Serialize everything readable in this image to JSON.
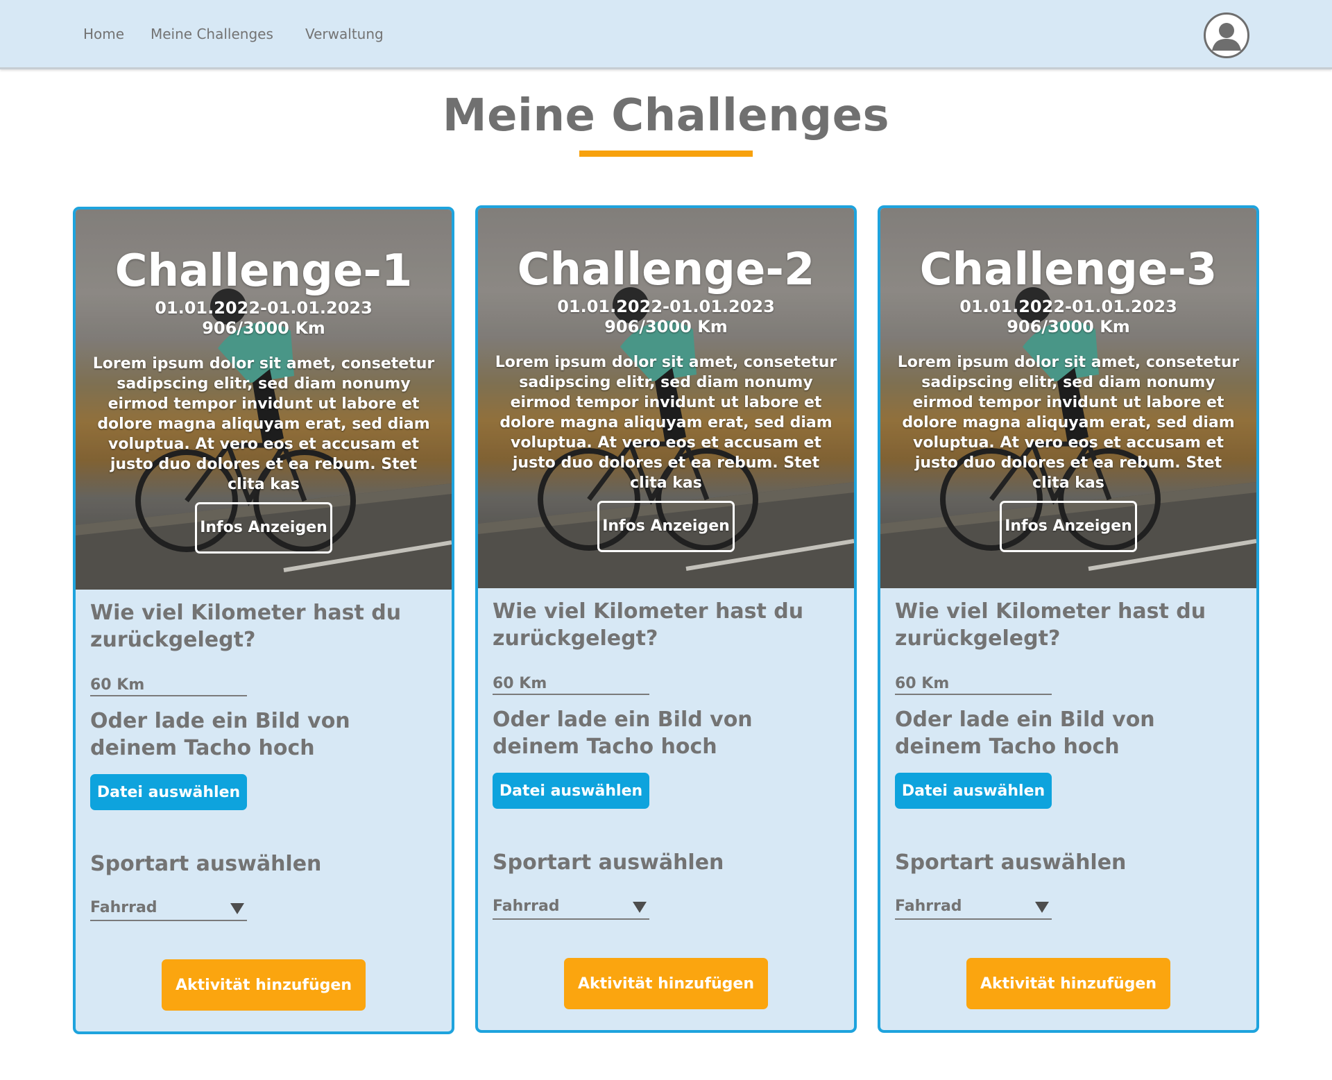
{
  "nav": {
    "links": [
      "Home",
      "Meine Challenges",
      "Verwaltung"
    ],
    "avatar_icon": "user-avatar-icon"
  },
  "page": {
    "title": "Meine Challenges",
    "accent_color": "#f7a10d"
  },
  "colors": {
    "nav_background": "#d7e8f5",
    "card_border": "#1ea3dd",
    "card_background": "#d7e8f5",
    "primary_button": "#0ea3dd",
    "action_button": "#fba50f",
    "text_gray": "#737373"
  },
  "cards": [
    {
      "title": "Challenge-1",
      "dates": "01.01.2022-01.01.2023",
      "progress": "906/3000 Km",
      "description": "Lorem ipsum dolor sit amet, consetetur sadipscing elitr, sed diam nonumy eirmod tempor invidunt ut labore et dolore magna aliquyam erat, sed diam voluptua. At vero eos et accusam et justo duo dolores et ea rebum. Stet clita kas",
      "info_button": "Infos Anzeigen",
      "km_question": "Wie viel Kilometer hast du zurückgelegt?",
      "km_placeholder": "60 Km",
      "upload_question": "Oder lade ein Bild von deinem Tacho hoch",
      "file_button": "Datei auswählen",
      "sport_question": "Sportart auswählen",
      "sport_selected": "Fahrrad",
      "add_button": "Aktivität hinzufügen"
    },
    {
      "title": "Challenge-2",
      "dates": "01.01.2022-01.01.2023",
      "progress": "906/3000 Km",
      "description": "Lorem ipsum dolor sit amet, consetetur sadipscing elitr, sed diam nonumy eirmod tempor invidunt ut labore et dolore magna aliquyam erat, sed diam voluptua. At vero eos et accusam et justo duo dolores et ea rebum. Stet clita kas",
      "info_button": "Infos Anzeigen",
      "km_question": "Wie viel Kilometer hast du zurückgelegt?",
      "km_placeholder": "60 Km",
      "upload_question": "Oder lade ein Bild von deinem Tacho hoch",
      "file_button": "Datei auswählen",
      "sport_question": "Sportart auswählen",
      "sport_selected": "Fahrrad",
      "add_button": "Aktivität hinzufügen"
    },
    {
      "title": "Challenge-3",
      "dates": "01.01.2022-01.01.2023",
      "progress": "906/3000 Km",
      "description": "Lorem ipsum dolor sit amet, consetetur sadipscing elitr, sed diam nonumy eirmod tempor invidunt ut labore et dolore magna aliquyam erat, sed diam voluptua. At vero eos et accusam et justo duo dolores et ea rebum. Stet clita kas",
      "info_button": "Infos Anzeigen",
      "km_question": "Wie viel Kilometer hast du zurückgelegt?",
      "km_placeholder": "60 Km",
      "upload_question": "Oder lade ein Bild von deinem Tacho hoch",
      "file_button": "Datei auswählen",
      "sport_question": "Sportart auswählen",
      "sport_selected": "Fahrrad",
      "add_button": "Aktivität hinzufügen"
    }
  ]
}
